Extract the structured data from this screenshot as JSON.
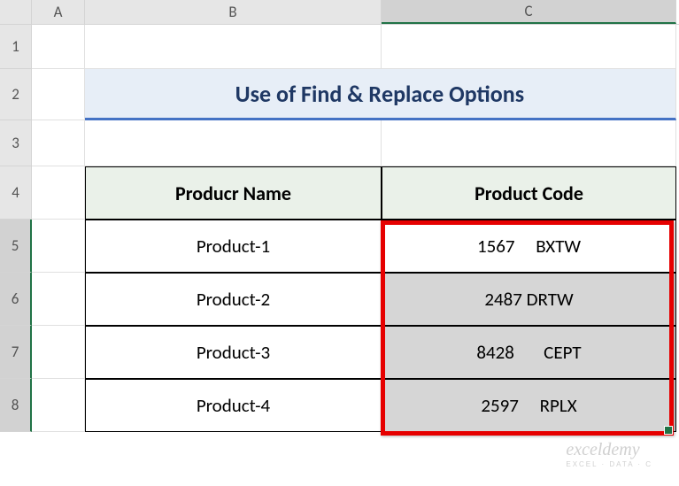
{
  "columns": {
    "A": "A",
    "B": "B",
    "C": "C"
  },
  "rows": {
    "r1": "1",
    "r2": "2",
    "r3": "3",
    "r4": "4",
    "r5": "5",
    "r6": "6",
    "r7": "7",
    "r8": "8"
  },
  "title": "Use of Find & Replace Options",
  "headers": {
    "name": "Producr Name",
    "code": "Product Code"
  },
  "data": [
    {
      "name": "Product-1",
      "code": "1567     BXTW"
    },
    {
      "name": "Product-2",
      "code": "2487 DRTW"
    },
    {
      "name": "Product-3",
      "code": "8428       CEPT"
    },
    {
      "name": "Product-4",
      "code": "2597     RPLX"
    }
  ],
  "watermark": {
    "brand": "exceldemy",
    "tag": "EXCEL · DATA · C"
  },
  "chart_data": {
    "type": "table",
    "title": "Use of Find & Replace Options",
    "columns": [
      "Producr Name",
      "Product Code"
    ],
    "rows": [
      [
        "Product-1",
        "1567     BXTW"
      ],
      [
        "Product-2",
        "2487 DRTW"
      ],
      [
        "Product-3",
        "8428       CEPT"
      ],
      [
        "Product-4",
        "2597     RPLX"
      ]
    ]
  }
}
